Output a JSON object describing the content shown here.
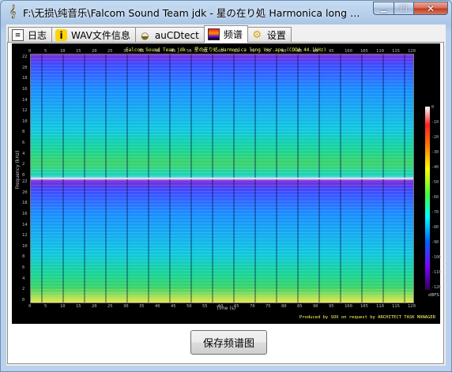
{
  "window": {
    "title": "F:\\无损\\纯音乐\\Falcom Sound Team jdk - 星の在り処 Harmonica long Ver....",
    "app_icon": "treble-clef-icon",
    "buttons": [
      "minimize",
      "maximize",
      "close"
    ]
  },
  "tabs": [
    {
      "label": "日志",
      "icon": "log-icon",
      "active": false
    },
    {
      "label": "WAV文件信息",
      "icon": "info-icon",
      "active": false
    },
    {
      "label": "auCDtect",
      "icon": "cd-analyzer-icon",
      "active": false
    },
    {
      "label": "频谱",
      "icon": "spectrogram-icon",
      "active": true
    },
    {
      "label": "设置",
      "icon": "settings-icon",
      "active": false
    }
  ],
  "spectrogram": {
    "title": "Falcom Sound Team jdk - 星の在り処 Harmonica long Ver.ape (CDDA 44.1kHz)",
    "y_axis_label": "Frequency (kHz)",
    "x_axis_label": "Time (s)",
    "credit": "Produced by SOX on request by ARCHITECT TASK MANAGER",
    "x_ticks": [
      "0",
      "5",
      "10",
      "15",
      "20",
      "25",
      "30",
      "35",
      "40",
      "45",
      "50",
      "55",
      "60",
      "65",
      "70",
      "75",
      "80",
      "85",
      "90",
      "95",
      "100",
      "105",
      "110",
      "115",
      "120"
    ],
    "y_ticks_top": [
      "22",
      "20",
      "18",
      "16",
      "14",
      "12",
      "10",
      "8",
      "6",
      "4",
      "2",
      "0"
    ],
    "y_ticks_bottom": [
      "22",
      "20",
      "18",
      "16",
      "14",
      "12",
      "10",
      "8",
      "6",
      "4",
      "2",
      "0"
    ],
    "colorbar_labels": [
      "0",
      "-10",
      "-20",
      "-30",
      "-40",
      "-50",
      "-60",
      "-70",
      "-80",
      "-90",
      "-100",
      "-110",
      "-120"
    ],
    "colorbar_unit": "dBFS"
  },
  "actions": {
    "save_label": "保存频谱图"
  },
  "colors": {
    "window_frame": "#b9d1ea",
    "spectrogram_bg": "#000000",
    "title_yellow": "#ffff66"
  }
}
